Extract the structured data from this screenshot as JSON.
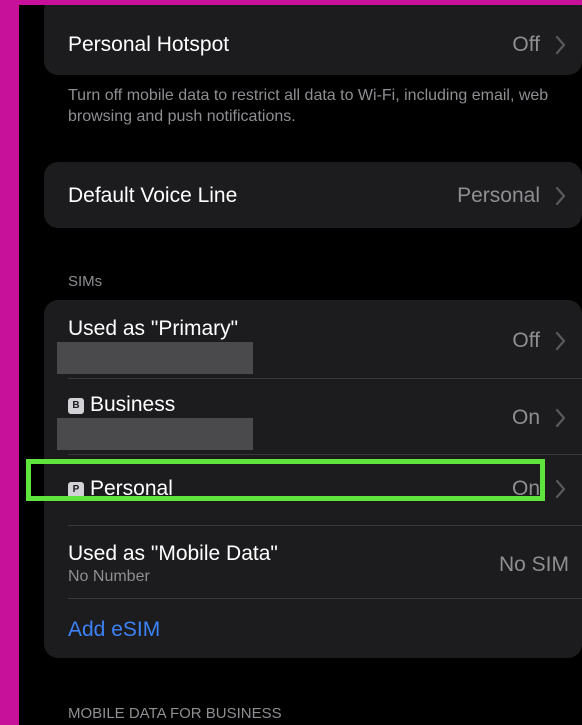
{
  "colors": {
    "background": "#c8119b",
    "screen": "#000000",
    "cell": "#1c1c1e",
    "secondary_text": "#8e8e93",
    "link": "#3b82f6",
    "highlight": "#5fe43d"
  },
  "hotspot": {
    "label": "Personal Hotspot",
    "value": "Off",
    "chevron_icon": "chevron-right-icon"
  },
  "mobile_data_footnote": "Turn off mobile data to restrict all data to Wi-Fi, including email, web browsing and push notifications.",
  "voice_line": {
    "label": "Default Voice Line",
    "value": "Personal",
    "chevron_icon": "chevron-right-icon"
  },
  "sims": {
    "header": "SIMs",
    "primary": {
      "label": "Used as \"Primary\"",
      "value": "Off"
    },
    "business": {
      "badge": "B",
      "label": "Business",
      "value": "On"
    },
    "personal": {
      "badge": "P",
      "label": "Personal",
      "value": "On"
    },
    "mobile_data": {
      "label": "Used as \"Mobile Data\"",
      "sublabel": "No Number",
      "value": "No SIM"
    },
    "add_esim": "Add eSIM"
  },
  "mobile_data_business_header": "MOBILE DATA FOR BUSINESS"
}
